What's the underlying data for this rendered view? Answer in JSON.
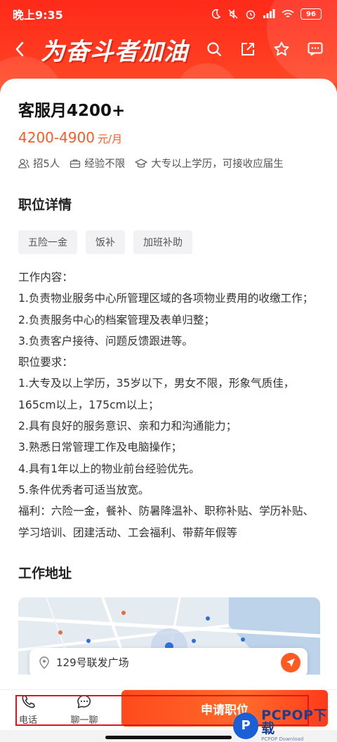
{
  "status_bar": {
    "time": "晚上9:35",
    "battery": "96"
  },
  "header": {
    "banner_title": "为奋斗者加油"
  },
  "job": {
    "title": "客服月4200+",
    "salary_range": "4200-4900",
    "salary_unit": "元/月",
    "meta": {
      "headcount": "招5人",
      "experience": "经验不限",
      "education": "大专以上学历，可接收应届生"
    }
  },
  "details": {
    "section_title": "职位详情",
    "tags": [
      "五险一金",
      "饭补",
      "加班补助"
    ],
    "description_lines": [
      "工作内容：",
      "1.负责物业服务中心所管理区域的各项物业费用的收缴工作；",
      "2.负责服务中心的档案管理及表单归整；",
      "3.负责客户接待、问题反馈跟进等。",
      "职位要求：",
      "1.大专及以上学历，35岁以下，男女不限，形象气质佳，165cm以上，175cm以上；",
      "2.具有良好的服务意识、亲和力和沟通能力；",
      "3.熟悉日常管理工作及电脑操作；",
      "4.具有1年以上的物业前台经验优先。",
      "5.条件优秀者可适当放宽。",
      "福利：六险一金，餐补、防暑降温补、职称补贴、学历补贴、学习培训、团建活动、工会福利、带薪年假等"
    ]
  },
  "address": {
    "section_title": "工作地址",
    "text": "129号联发广场"
  },
  "bottom_bar": {
    "phone_label": "电话",
    "chat_label": "聊一聊",
    "apply_label": "申请职位"
  },
  "watermark": {
    "logo_letter": "P",
    "main": "PCPOP下载",
    "sub": "PCPOP Download"
  },
  "colors": {
    "brand_red": "#ff2a1a",
    "salary_orange": "#ff5a22",
    "highlight_red": "#e2151a"
  }
}
